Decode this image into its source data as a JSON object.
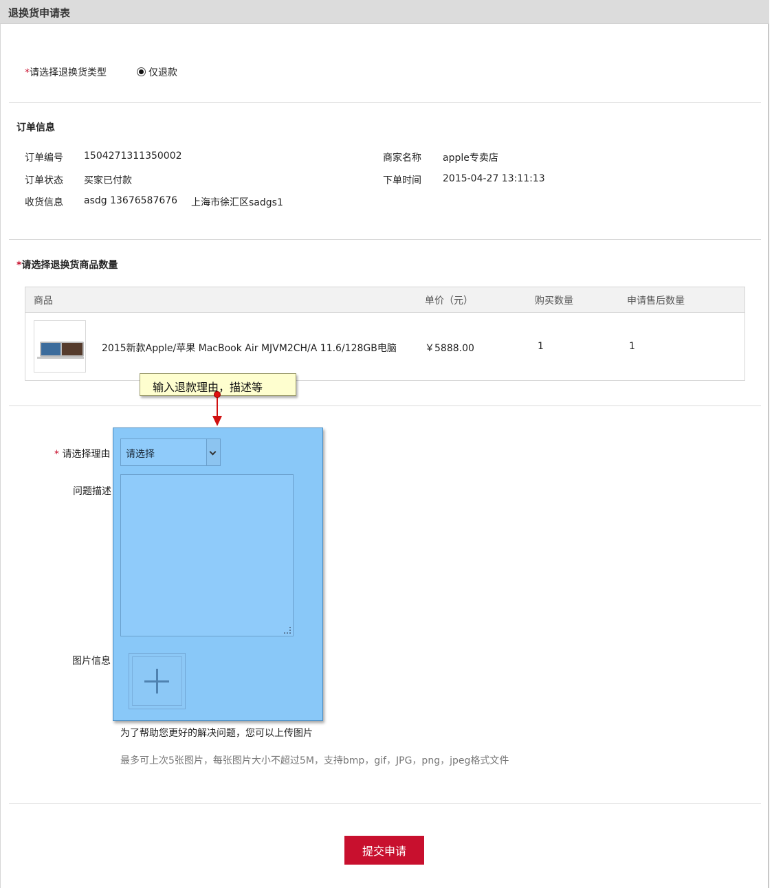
{
  "page": {
    "title": "退换货申请表"
  },
  "type_section": {
    "label": "请选择退换货类型",
    "required_mark": "*",
    "options": [
      "仅退款"
    ]
  },
  "order_info": {
    "heading": "订单信息",
    "order_no_label": "订单编号",
    "order_no": "1504271311350002",
    "status_label": "订单状态",
    "status": "买家已付款",
    "shipping_label": "收货信息",
    "shipping_contact": "asdg 13676587676",
    "shipping_address": "上海市徐汇区sadgs1",
    "merchant_label": "商家名称",
    "merchant": "apple专卖店",
    "order_time_label": "下单时间",
    "order_time": "2015-04-27 13:11:13"
  },
  "items_section": {
    "required_mark": "*",
    "heading": "请选择退换货商品数量",
    "columns": [
      "商品",
      "单价（元）",
      "购买数量",
      "申请售后数量"
    ],
    "rows": [
      {
        "name": "2015新款Apple/苹果 MacBook Air MJVM2CH/A 11.6/128GB电脑",
        "price": "￥5888.00",
        "qty": "1",
        "apply_qty": "1"
      }
    ]
  },
  "tooltip": {
    "text": "输入退款理由，描述等"
  },
  "reason_section": {
    "required_mark": "*",
    "reason_label": "请选择理由",
    "reason_selected": "请选择",
    "description_label": "问题描述",
    "image_label": "图片信息",
    "help_text": "为了帮助您更好的解决问题，您可以上传图片",
    "limit_text": "最多可上次5张图片，每张图片大小不超过5M，支持bmp，gif，JPG，png，jpeg格式文件"
  },
  "submit": {
    "label": "提交申请"
  }
}
